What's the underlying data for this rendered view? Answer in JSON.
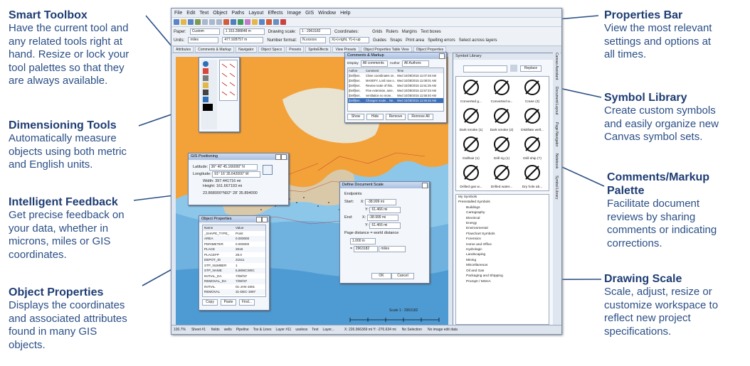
{
  "callouts": {
    "smart_toolbox": {
      "title": "Smart Toolbox",
      "body": [
        "Have the current tool and",
        "any related tools right at",
        "hand. Resize or lock your",
        "tool palettes so that they",
        "are always available."
      ]
    },
    "dimensioning": {
      "title": "Dimensioning Tools",
      "body": [
        "Automatically measure",
        "objects using both metric",
        "and English units."
      ]
    },
    "feedback": {
      "title": "Intelligent Feedback",
      "body": [
        "Get precise feedback on",
        "your data, whether in",
        "microns, miles or GIS",
        "coordinates."
      ]
    },
    "object_props": {
      "title": "Object Properties",
      "body": [
        "Displays the coordinates",
        "and associated attributes",
        "found in many GIS",
        "objects."
      ]
    },
    "properties_bar": {
      "title": "Properties Bar",
      "body": [
        "View the most relevant",
        "settings and options at",
        "all times."
      ]
    },
    "symbol_library": {
      "title": "Symbol Library",
      "body": [
        "Create custom symbols",
        "and easily organize new",
        "Canvas symbol sets."
      ]
    },
    "comments": {
      "title": "Comments/Markup",
      "title2": "Palette",
      "body": [
        "Facilitate document",
        "reviews by sharing",
        "comments or indicating",
        "corrections."
      ]
    },
    "drawing_scale": {
      "title": "Drawing Scale",
      "body": [
        "Scale, adjust, resize or",
        "customize workspace to",
        "reflect new project",
        "specifications."
      ]
    }
  },
  "app": {
    "menu": [
      "File",
      "Edit",
      "Text",
      "Object",
      "Paths",
      "Layout",
      "Effects",
      "Image",
      "GIS",
      "Window",
      "Help"
    ],
    "propbar": {
      "paper_label": "Paper:",
      "paper_value": "Custom",
      "units_label": "Units:",
      "units_value": "miles",
      "x_value": "1 153.288848 m",
      "y_value": "477.928757 m",
      "drawing_scale_label": "Drawing scale:",
      "drawing_scale_value": "1 : 2963182",
      "number_format_label": "Number format:",
      "number_format_value": "N.xxxxxx",
      "coordinates_label": "Coordinates:",
      "coordinates_value": "X(+)-right, Y(+)-up",
      "checks": [
        "Grids",
        "Guides",
        "Rulers",
        "Snaps",
        "Margins",
        "Print area",
        "Text boxes",
        "Spelling errors",
        "Select across layers"
      ]
    },
    "tabs": [
      "Attributes",
      "Comments & Markup",
      "Navigator",
      "Object Specs",
      "Presets",
      "SpriteEffects",
      "View Presets",
      "Object Properties Table View",
      "Object Properties"
    ],
    "gis_positioning": {
      "title": "GIS Positioning",
      "lat_label": "Latitude:",
      "lat_value": "36° 40' 45.166000\" N",
      "lon_label": "Longitude:",
      "lon_value": "91° 16' 35.642000\" W",
      "width": "Width: 397.441716 mi",
      "height": "Height: 161.667193 mi",
      "angle": "23.868000°N92° 28' 35.894000"
    },
    "doc_scale": {
      "title": "Define Document Scale",
      "endpoints": "Endpoints",
      "start": "Start:",
      "end": "End:",
      "x": "X:",
      "y": "Y:",
      "start_x": "-38.999 mi",
      "start_y": "61.466 mi",
      "end_x": "-38.999 mi",
      "end_y": "61.466 mi",
      "ratio_label": "Page distance = world distance",
      "page_dist": "1.000 in",
      "world_dist": "2963182",
      "world_unit": "miles",
      "ok": "OK",
      "cancel": "Cancel"
    },
    "comments_palette": {
      "title": "Comments & Markup",
      "display_label": "Display",
      "display_value": "All comments",
      "author_label": "Author",
      "author_value": "All Authors",
      "cols": [
        "Author",
        "Comment",
        "Time"
      ],
      "rows": [
        [
          "[Dell]ser..",
          "Close coordinates on..",
          "Wed 10/28/2015 11:07:48 AM"
        ],
        [
          "[Dell]ser..",
          "MASEFY, Lord now o..",
          "Wed 10/28/2015 11:08:01 AM"
        ],
        [
          "[Dell]ser..",
          "Review scale of this..",
          "Wed 10/28/2015 11:51:25 AM"
        ],
        [
          "[Dell]ser..",
          "Fine extension, ame..",
          "Wed 10/28/2015 11:57:23 AM"
        ],
        [
          "[Dell]ser..",
          "ventilation no more..",
          "Wed 10/28/2015 11:58:40 AM"
        ],
        [
          "[Dell]ser..",
          "Changes made... Ne..",
          "Wed 10/28/2015 11:59:45 AM"
        ]
      ],
      "buttons": [
        "Show",
        "Hide",
        "Remove",
        "Remove All"
      ]
    },
    "object_props": {
      "title": "Object Properties",
      "cols": [
        "Name",
        "Value"
      ],
      "rows": [
        [
          "_SHAPE_TYPE_",
          "Point"
        ],
        [
          "AREA",
          "0.000000"
        ],
        [
          "PERIMETER",
          "0.000000"
        ],
        [
          "PLACE",
          "2618"
        ],
        [
          "PLACEFP",
          "28.0"
        ],
        [
          "DEPOT_ID",
          "21511"
        ],
        [
          "STP_NUMBER",
          "1"
        ],
        [
          "STP_NAME",
          "IL88WCW0C"
        ],
        [
          "INITIAL_DA",
          "7/08/'87"
        ],
        [
          "REMOVAL_DA",
          "7/09/'87"
        ],
        [
          "INITIAL",
          "01-JAN-1901"
        ],
        [
          "REMOVAL",
          "31-DEC-1997"
        ]
      ],
      "buttons": [
        "Copy",
        "Paste",
        "Find..."
      ]
    },
    "symbol_library": {
      "title": "Symbol Library",
      "replace": "Replace",
      "symbols": [
        "Converted g...",
        "Converted w...",
        "Crane (3)",
        "Dark smoke (1)",
        "Dark smoke (2)",
        "Distillate well...",
        "Dollhair (1)",
        "Drill rig (1)",
        "Drill ship (?)",
        "Drilled gas w...",
        "Drilled water...",
        "Dry hole ab..."
      ],
      "tree": [
        "My Symbols",
        "Preinstalled Symbols",
        "Buildings",
        "Cartography",
        "Electrical",
        "Energy",
        "Environmental",
        "Flowchart Symbols",
        "Forensics",
        "Home and Office",
        "Hydrologic",
        "Landscaping",
        "Mining",
        "Miscellaneous",
        "Oil and Gas",
        "Packaging and Shipping",
        "Prompt! / MSHA"
      ],
      "side_tabs": [
        "Canvas Assistant",
        "Document Layout",
        "Page Navigator",
        "Notebook",
        "Symbol Library"
      ]
    },
    "status": {
      "zoom": "100.7%",
      "sheet": "Sheet #1",
      "layer_items": [
        "fields",
        "wells",
        "Pipeline",
        "Tox & Lines",
        "Layer #11",
        "useless",
        "Text",
        "Layer..."
      ],
      "coords": "X: 226.966369 mi  Y: -276.634 mi",
      "selection": "No Selection",
      "image": "No image edit data"
    },
    "map": {
      "scale_label": "Scale 1 : 2963182"
    }
  }
}
